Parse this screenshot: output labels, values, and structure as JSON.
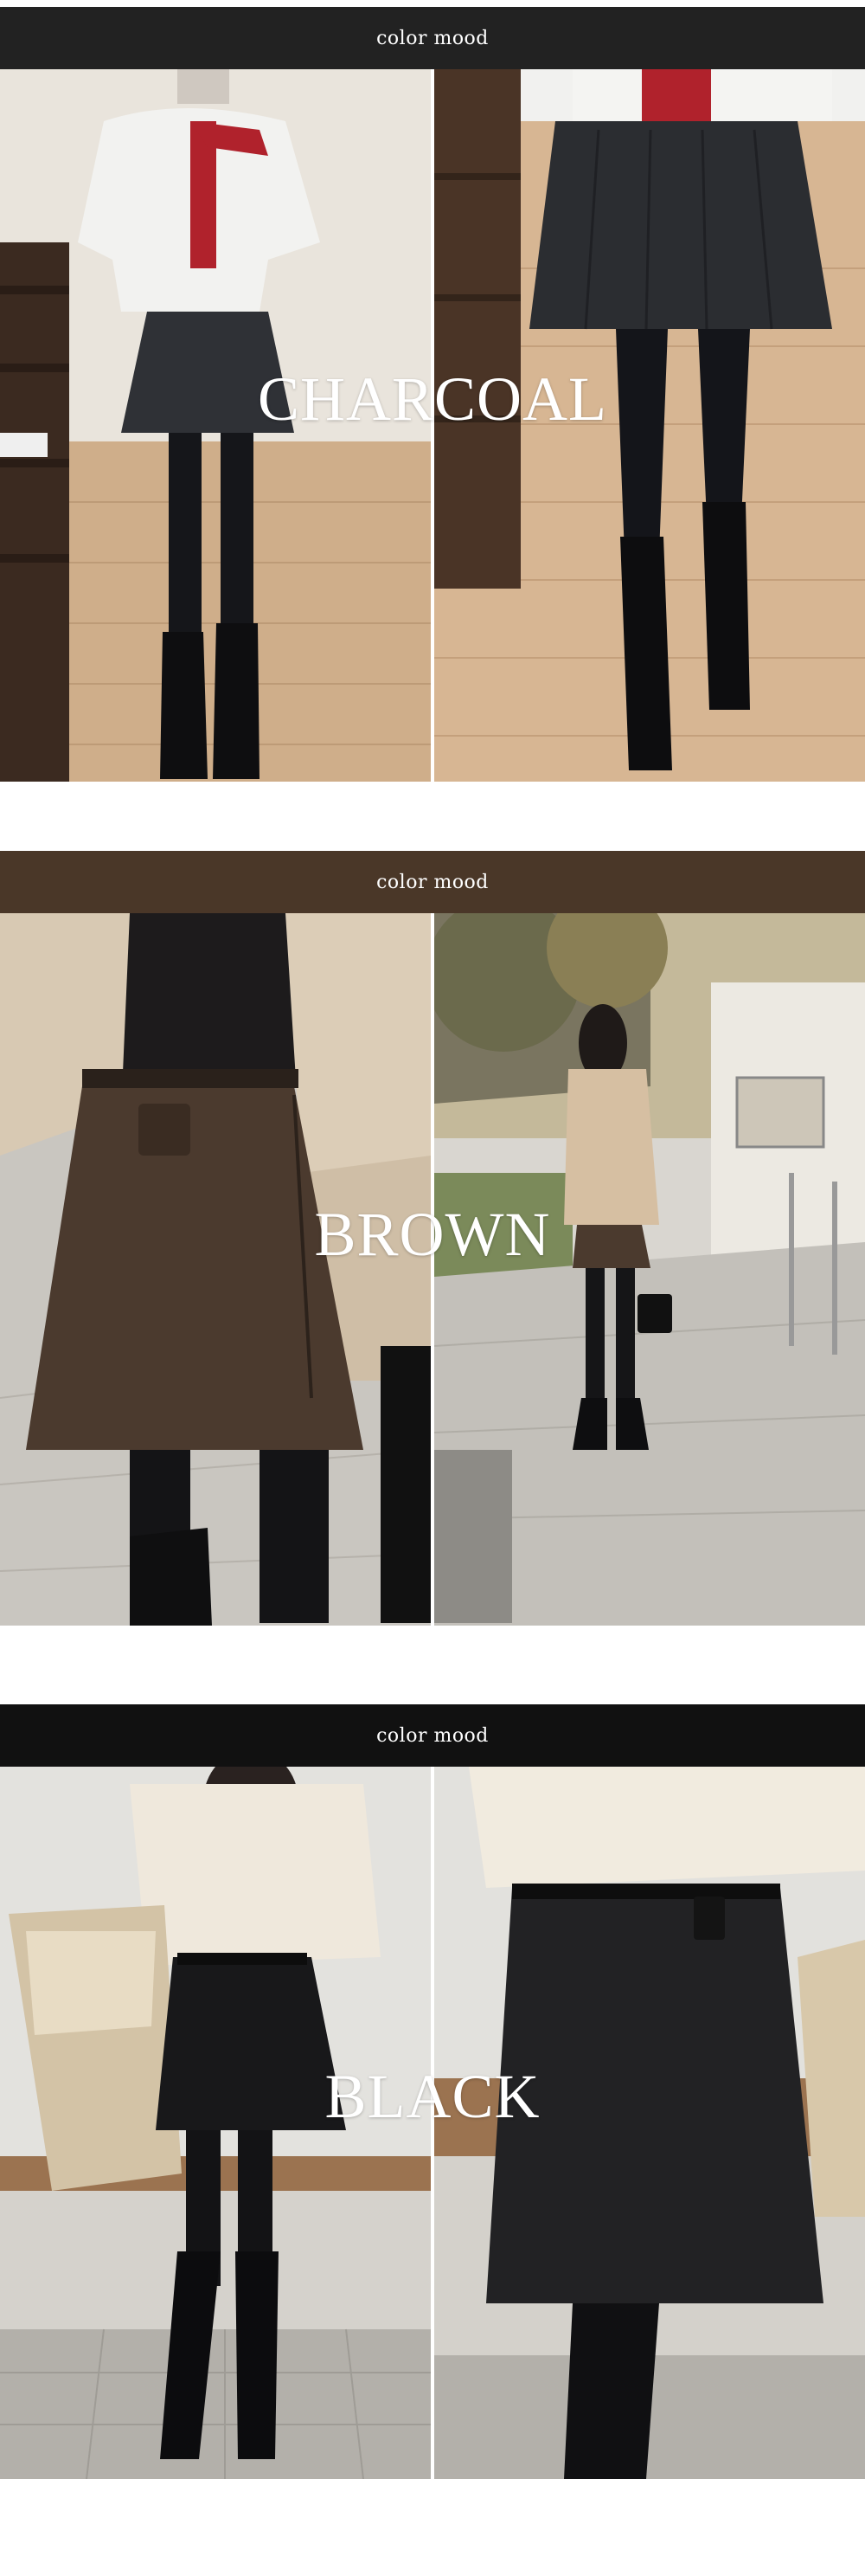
{
  "sections": [
    {
      "bar_label": "color mood",
      "color_name": "CHARCOAL",
      "bar_color": "#222222"
    },
    {
      "bar_label": "color mood",
      "color_name": "BROWN",
      "bar_color": "#4a3728"
    },
    {
      "bar_label": "color mood",
      "color_name": "BLACK",
      "bar_color": "#111111"
    }
  ]
}
